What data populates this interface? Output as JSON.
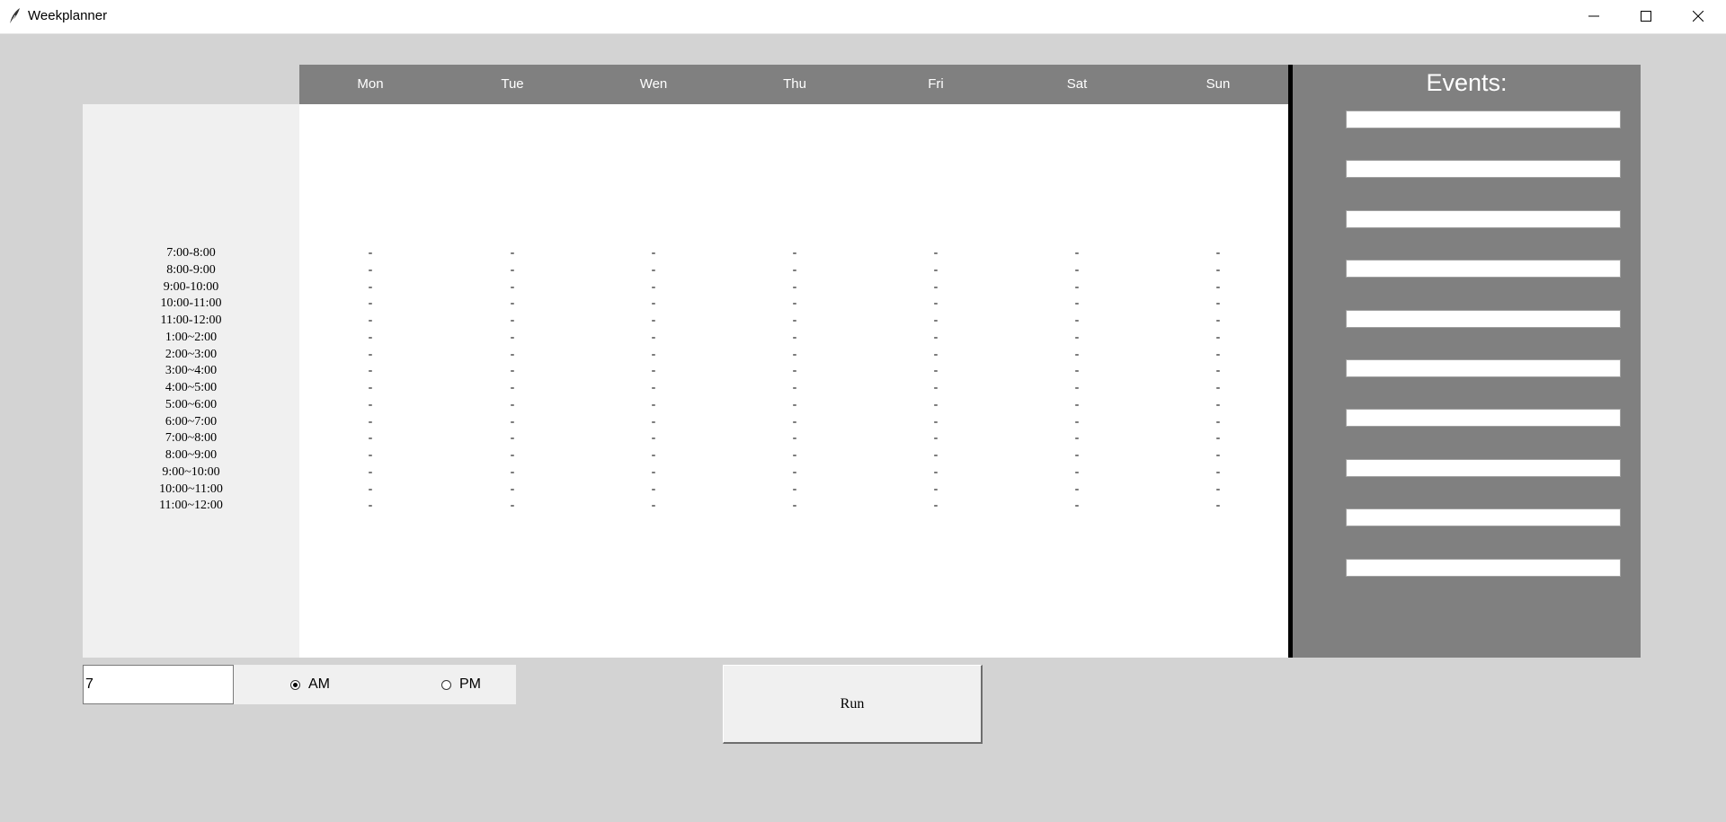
{
  "window": {
    "title": "Weekplanner",
    "icon": "feather-icon",
    "controls": [
      "minimize-icon",
      "maximize-icon",
      "close-icon"
    ]
  },
  "days": [
    "Mon",
    "Tue",
    "Wen",
    "Thu",
    "Fri",
    "Sat",
    "Sun"
  ],
  "time_slots": [
    "7:00-8:00",
    "8:00-9:00",
    "9:00-10:00",
    "10:00-11:00",
    "11:00-12:00",
    "1:00~2:00",
    "2:00~3:00",
    "3:00~4:00",
    "4:00~5:00",
    "5:00~6:00",
    "6:00~7:00",
    "7:00~8:00",
    "8:00~9:00",
    "9:00~10:00",
    "10:00~11:00",
    "11:00~12:00"
  ],
  "empty_cell": "-",
  "events": {
    "title": "Events:",
    "entries": [
      "",
      "",
      "",
      "",
      "",
      "",
      "",
      "",
      "",
      ""
    ]
  },
  "controls": {
    "hour_value": "7",
    "am_label": "AM",
    "pm_label": "PM",
    "selected_period": "AM",
    "run_label": "Run"
  },
  "colors": {
    "background": "#d3d3d3",
    "header": "#808080",
    "events_panel": "#808080",
    "time_column": "#f0f0f0",
    "grid": "#ffffff"
  }
}
